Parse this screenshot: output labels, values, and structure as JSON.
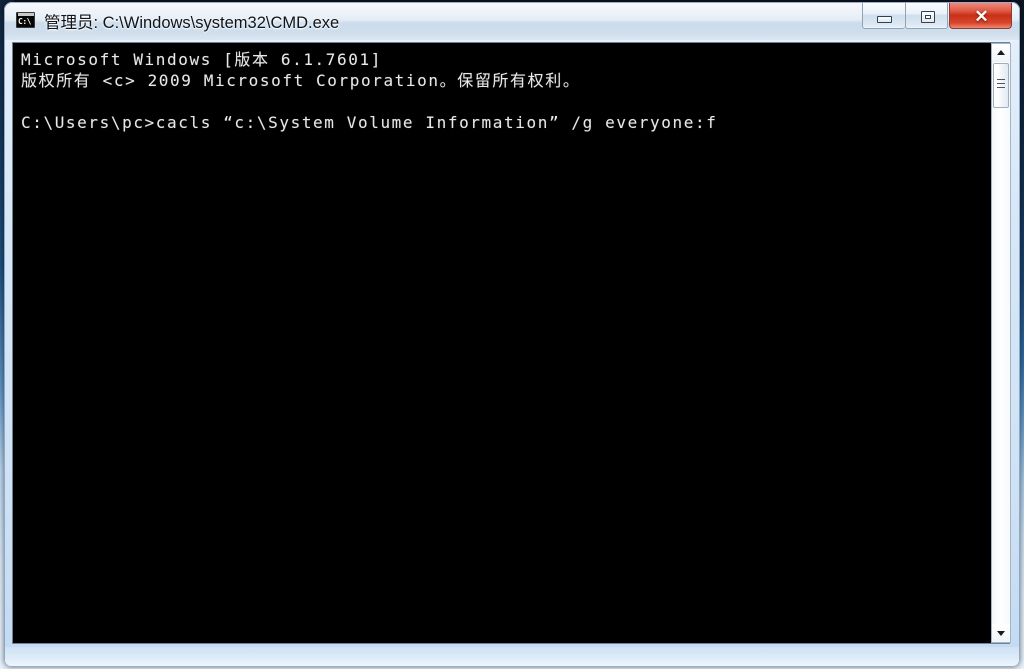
{
  "window": {
    "title": "管理员: C:\\Windows\\system32\\CMD.exe",
    "icon_name": "cmd-icon",
    "icon_text": "C:\\",
    "controls": {
      "minimize_label": "最小化",
      "maximize_label": "还原",
      "close_label": "✕"
    }
  },
  "console": {
    "lines": [
      "Microsoft Windows [版本 6.1.7601]",
      "版权所有 <c> 2009 Microsoft Corporation。保留所有权利。",
      "",
      "C:\\Users\\pc>cacls “c:\\System Volume Information” /g everyone:f"
    ],
    "prompt": "C:\\Users\\pc>",
    "command": "cacls “c:\\System Volume Information” /g everyone:f",
    "foreground_color": "#e8e8e8",
    "background_color": "#000000"
  },
  "scrollbar": {
    "up_arrow": "▲",
    "down_arrow": "▼",
    "position": "top"
  },
  "theme": {
    "frame_color": "#d7e7f7",
    "close_button_color": "#c92f17",
    "accent_color": "#6e8295"
  }
}
